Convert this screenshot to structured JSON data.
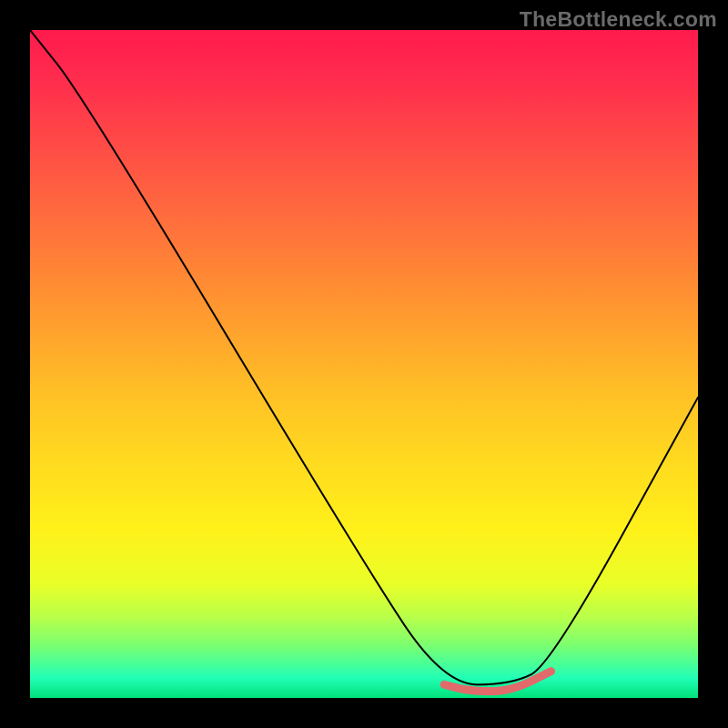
{
  "watermark": "TheBottleneck.com",
  "chart_data": {
    "type": "line",
    "title": "",
    "xlabel": "",
    "ylabel": "",
    "xlim": [
      0,
      100
    ],
    "ylim": [
      0,
      100
    ],
    "series": [
      {
        "name": "bottleneck-curve",
        "x": [
          0,
          8,
          50,
          62,
          72,
          78,
          100
        ],
        "values": [
          100,
          90,
          20,
          2,
          2,
          5,
          45
        ]
      }
    ],
    "highlight_segment": {
      "name": "low-bottleneck-region",
      "x": [
        62,
        66,
        72,
        78
      ],
      "values": [
        2,
        1,
        1,
        4
      ]
    },
    "background_gradient": {
      "top": "#ff1a4d",
      "bottom": "#00e07a"
    }
  }
}
